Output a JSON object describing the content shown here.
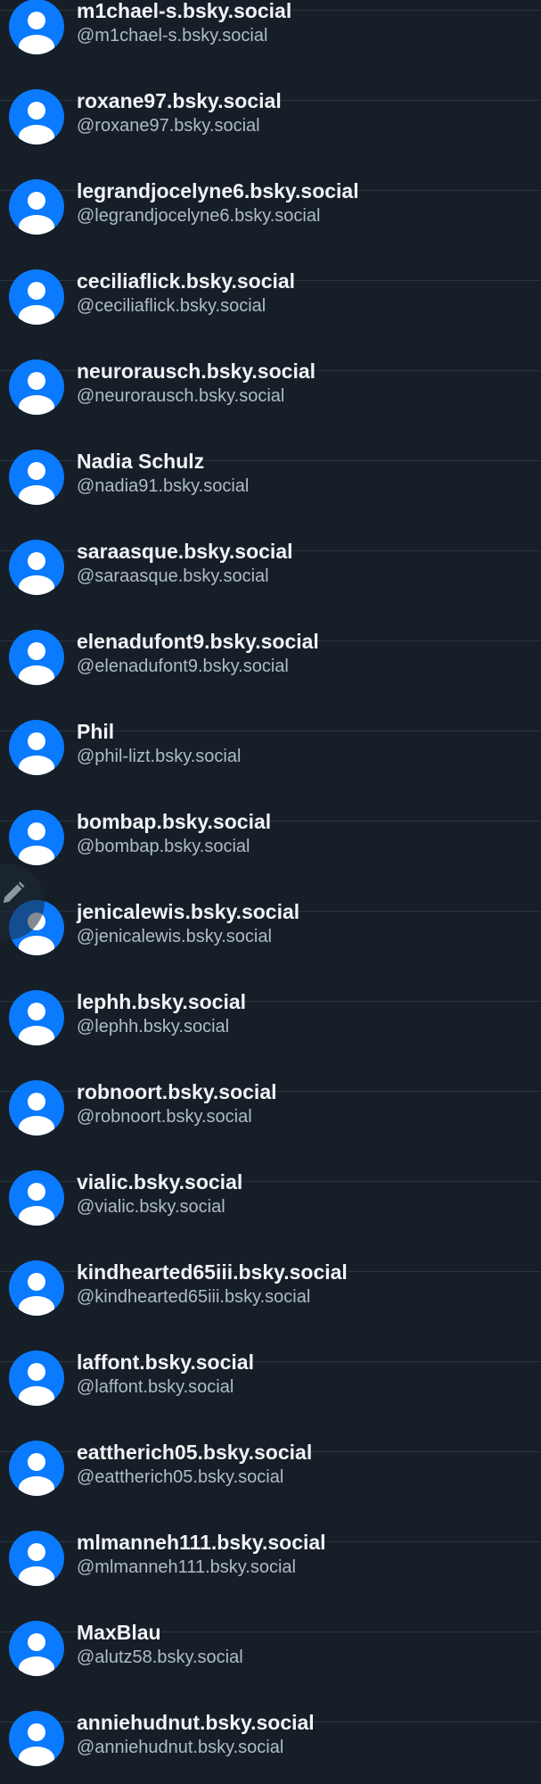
{
  "colors": {
    "background": "#161e27",
    "avatar": "#0a7aff",
    "name_text": "#f1f3f5",
    "handle_text": "#aebbc9",
    "divider": "#2a3442"
  },
  "compose_button": {
    "icon": "pencil-icon"
  },
  "users": [
    {
      "name": "m1chael-s.bsky.social",
      "handle": "@m1chael-s.bsky.social"
    },
    {
      "name": "roxane97.bsky.social",
      "handle": "@roxane97.bsky.social"
    },
    {
      "name": "legrandjocelyne6.bsky.social",
      "handle": "@legrandjocelyne6.bsky.social"
    },
    {
      "name": "ceciliaflick.bsky.social",
      "handle": "@ceciliaflick.bsky.social"
    },
    {
      "name": "neurorausch.bsky.social",
      "handle": "@neurorausch.bsky.social"
    },
    {
      "name": "Nadia Schulz",
      "handle": "@nadia91.bsky.social"
    },
    {
      "name": "saraasque.bsky.social",
      "handle": "@saraasque.bsky.social"
    },
    {
      "name": "elenadufont9.bsky.social",
      "handle": "@elenadufont9.bsky.social"
    },
    {
      "name": "Phil",
      "handle": "@phil-lizt.bsky.social"
    },
    {
      "name": "bombap.bsky.social",
      "handle": "@bombap.bsky.social"
    },
    {
      "name": "jenicalewis.bsky.social",
      "handle": "@jenicalewis.bsky.social"
    },
    {
      "name": "lephh.bsky.social",
      "handle": "@lephh.bsky.social"
    },
    {
      "name": "robnoort.bsky.social",
      "handle": "@robnoort.bsky.social"
    },
    {
      "name": "vialic.bsky.social",
      "handle": "@vialic.bsky.social"
    },
    {
      "name": "kindhearted65iii.bsky.social",
      "handle": "@kindhearted65iii.bsky.social"
    },
    {
      "name": "laffont.bsky.social",
      "handle": "@laffont.bsky.social"
    },
    {
      "name": "eattherich05.bsky.social",
      "handle": "@eattherich05.bsky.social"
    },
    {
      "name": "mlmanneh111.bsky.social",
      "handle": "@mlmanneh111.bsky.social"
    },
    {
      "name": "MaxBlau",
      "handle": "@alutz58.bsky.social"
    },
    {
      "name": "anniehudnut.bsky.social",
      "handle": "@anniehudnut.bsky.social"
    }
  ]
}
